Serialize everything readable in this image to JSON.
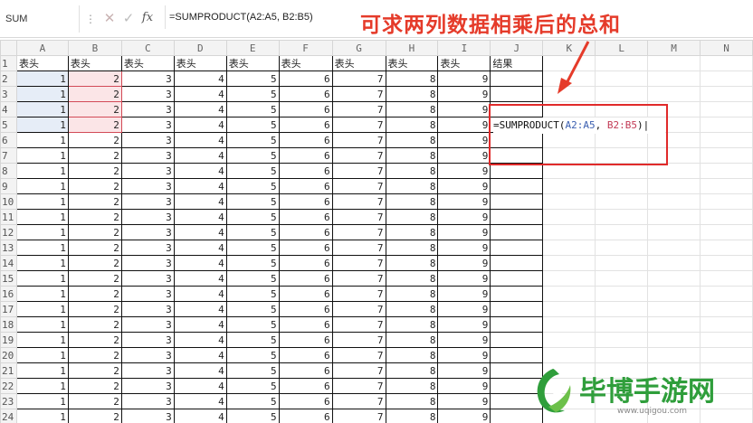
{
  "formula_bar": {
    "name_box": "SUM",
    "dots": "⋮",
    "cancel": "✕",
    "confirm": "✓",
    "fx": "fx",
    "formula": "=SUMPRODUCT(A2:A5, B2:B5)"
  },
  "grid": {
    "columns": [
      "A",
      "B",
      "C",
      "D",
      "E",
      "F",
      "G",
      "H",
      "I",
      "J",
      "K",
      "L",
      "M",
      "N"
    ],
    "header_row": [
      "表头",
      "表头",
      "表头",
      "表头",
      "表头",
      "表头",
      "表头",
      "表头",
      "表头",
      "结果"
    ],
    "row_values": [
      1,
      2,
      3,
      4,
      5,
      6,
      7,
      8,
      9
    ],
    "rows": [
      "1",
      "2",
      "3",
      "4",
      "5",
      "6",
      "7",
      "8",
      "9",
      "10",
      "11",
      "12",
      "13",
      "14",
      "15",
      "16",
      "17",
      "18",
      "19",
      "20",
      "21",
      "22",
      "23",
      "24"
    ]
  },
  "editor": {
    "prefix": "=SUMPRODUCT(",
    "ref_a": "A2:A5",
    "sep": ", ",
    "ref_b": "B2:B5",
    "suffix": ")"
  },
  "callout": "可求两列数据相乘后的总和",
  "watermark": {
    "title": "毕博手游网",
    "url": "www.uqigou.com"
  },
  "colors": {
    "callout": "#e53b2a",
    "box": "#e02a2a",
    "watermark": "#2f9e3b"
  }
}
